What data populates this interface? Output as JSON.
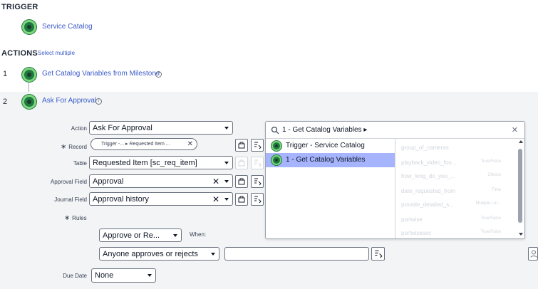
{
  "trigger": {
    "heading": "TRIGGER",
    "name": "Service Catalog"
  },
  "actions": {
    "heading": "ACTIONS",
    "select_multiple": "Select multiple",
    "steps": [
      {
        "number": "1",
        "name": "Get Catalog Variables from Milestone"
      },
      {
        "number": "2",
        "name": "Ask For Approval"
      }
    ]
  },
  "form": {
    "action_label": "Action",
    "action_value": "Ask For Approval",
    "record_label": "Record",
    "record_pill": "Trigger -...  ▸ Requested Item ...",
    "table_label": "Table",
    "table_value": "Requested Item [sc_req_item]",
    "approval_field_label": "Approval Field",
    "approval_field_value": "Approval",
    "journal_field_label": "Journal Field",
    "journal_field_value": "Approval history",
    "rules_label": "Rules",
    "rule_type_value": "Approve or Re...",
    "when_label": "When:",
    "rule_condition_value": "Anyone approves or rejects",
    "due_date_label": "Due Date",
    "due_date_value": "None"
  },
  "picker": {
    "search_value": "1 - Get Catalog Variables ▸",
    "sources": [
      {
        "label": "Trigger - Service Catalog",
        "selected": false
      },
      {
        "label": "1 - Get Catalog Variables",
        "selected": true
      }
    ],
    "variables": [
      {
        "name": "group_of_cameras",
        "type": ""
      },
      {
        "name": "playback_video_foo...",
        "type": "True/False"
      },
      {
        "name": "how_long_do_you_...",
        "type": "Choice"
      },
      {
        "name": "date_requested_from",
        "type": "Time"
      },
      {
        "name": "provide_detailed_s...",
        "type": "Multiple Lin..."
      },
      {
        "name": "portwise",
        "type": "True/False"
      },
      {
        "name": "portwisesec",
        "type": "True/False"
      }
    ]
  },
  "colors": {
    "link": "#3b5bc7",
    "selected": "#a5b4fc",
    "icon_green": "#7ed67e"
  }
}
